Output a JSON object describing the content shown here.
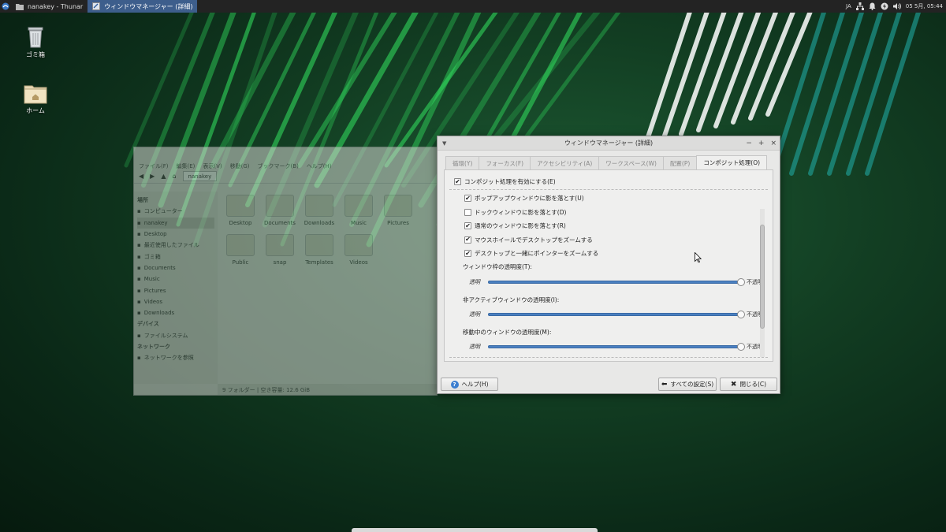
{
  "panel": {
    "tasks": [
      {
        "label": "nanakey - Thunar",
        "icon": "folder-icon",
        "active": false
      },
      {
        "label": "ウィンドウマネージャー (詳細)",
        "icon": "window-manager-icon",
        "active": true
      }
    ],
    "tray": {
      "lang": "JA",
      "clock": "05 5月, 05:44"
    }
  },
  "desktop": {
    "icons": [
      {
        "label": "ゴミ箱",
        "icon": "trash-icon"
      },
      {
        "label": "ホーム",
        "icon": "home-folder-icon"
      }
    ]
  },
  "thunar": {
    "menu": [
      "ファイル(F)",
      "編集(E)",
      "表示(V)",
      "移動(G)",
      "ブックマーク(B)",
      "ヘルプ(H)"
    ],
    "path": "nanakey",
    "sidebar": [
      {
        "label": "場所",
        "header": true
      },
      {
        "label": "コンピューター",
        "icon": "computer-icon"
      },
      {
        "label": "nanakey",
        "icon": "home-icon",
        "selected": true
      },
      {
        "label": "Desktop",
        "icon": "desktop-icon"
      },
      {
        "label": "最近使用したファイル",
        "icon": "recent-icon"
      },
      {
        "label": "ゴミ箱",
        "icon": "trash-icon"
      },
      {
        "label": "Documents",
        "icon": "documents-icon"
      },
      {
        "label": "Music",
        "icon": "music-icon"
      },
      {
        "label": "Pictures",
        "icon": "pictures-icon"
      },
      {
        "label": "Videos",
        "icon": "videos-icon"
      },
      {
        "label": "Downloads",
        "icon": "downloads-icon"
      },
      {
        "label": "デバイス",
        "header": true
      },
      {
        "label": "ファイルシステム",
        "icon": "drive-icon"
      },
      {
        "label": "ネットワーク",
        "header": true
      },
      {
        "label": "ネットワークを参照",
        "icon": "network-icon"
      }
    ],
    "files": [
      "Desktop",
      "Documents",
      "Downloads",
      "Music",
      "Pictures",
      "Public",
      "snap",
      "Templates",
      "Videos"
    ],
    "status": "9 フォルダー | 空き容量: 12.6 GiB"
  },
  "dialog": {
    "title": "ウィンドウマネージャー (詳細)",
    "tabs": [
      "循環(Y)",
      "フォーカス(F)",
      "アクセシビリティ(A)",
      "ワークスペース(W)",
      "配置(P)",
      "コンポジット処理(O)"
    ],
    "active_tab": 5,
    "main_checkbox": {
      "label": "コンポジット処理を有効にする(E)",
      "checked": true
    },
    "options": [
      {
        "label": "ポップアップウィンドウに影を落とす(U)",
        "checked": true
      },
      {
        "label": "ドックウィンドウに影を落とす(D)",
        "checked": false
      },
      {
        "label": "通常のウィンドウに影を落とす(R)",
        "checked": true
      },
      {
        "label": "マウスホイールでデスクトップをズームする",
        "checked": true
      },
      {
        "label": "デスクトップと一緒にポインターをズームする",
        "checked": true
      }
    ],
    "sliders": [
      {
        "label": "ウィンドウ枠の透明度(T):",
        "min_label": "透明",
        "max_label": "不透明",
        "value": 1.0
      },
      {
        "label": "非アクティブウィンドウの透明度(I):",
        "min_label": "透明",
        "max_label": "不透明",
        "value": 1.0
      },
      {
        "label": "移動中のウィンドウの透明度(M):",
        "min_label": "透明",
        "max_label": "不透明",
        "value": 1.0
      }
    ],
    "buttons": {
      "help": "ヘルプ(H)",
      "all_settings": "すべての設定(S)",
      "close": "閉じる(C)"
    }
  }
}
